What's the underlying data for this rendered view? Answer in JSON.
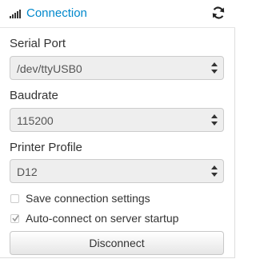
{
  "header": {
    "title": "Connection",
    "icons": {
      "left": "signal-bars-icon",
      "right": "refresh-icon"
    },
    "accent_color": "#0088cc"
  },
  "form": {
    "serial_port": {
      "label": "Serial Port",
      "value": "/dev/ttyUSB0"
    },
    "baudrate": {
      "label": "Baudrate",
      "value": "115200"
    },
    "printer_profile": {
      "label": "Printer Profile",
      "value": "D12"
    },
    "save_settings": {
      "label": "Save connection settings",
      "checked": false
    },
    "auto_connect": {
      "label": "Auto-connect on server startup",
      "checked": true
    },
    "disconnect_button": {
      "label": "Disconnect"
    }
  }
}
